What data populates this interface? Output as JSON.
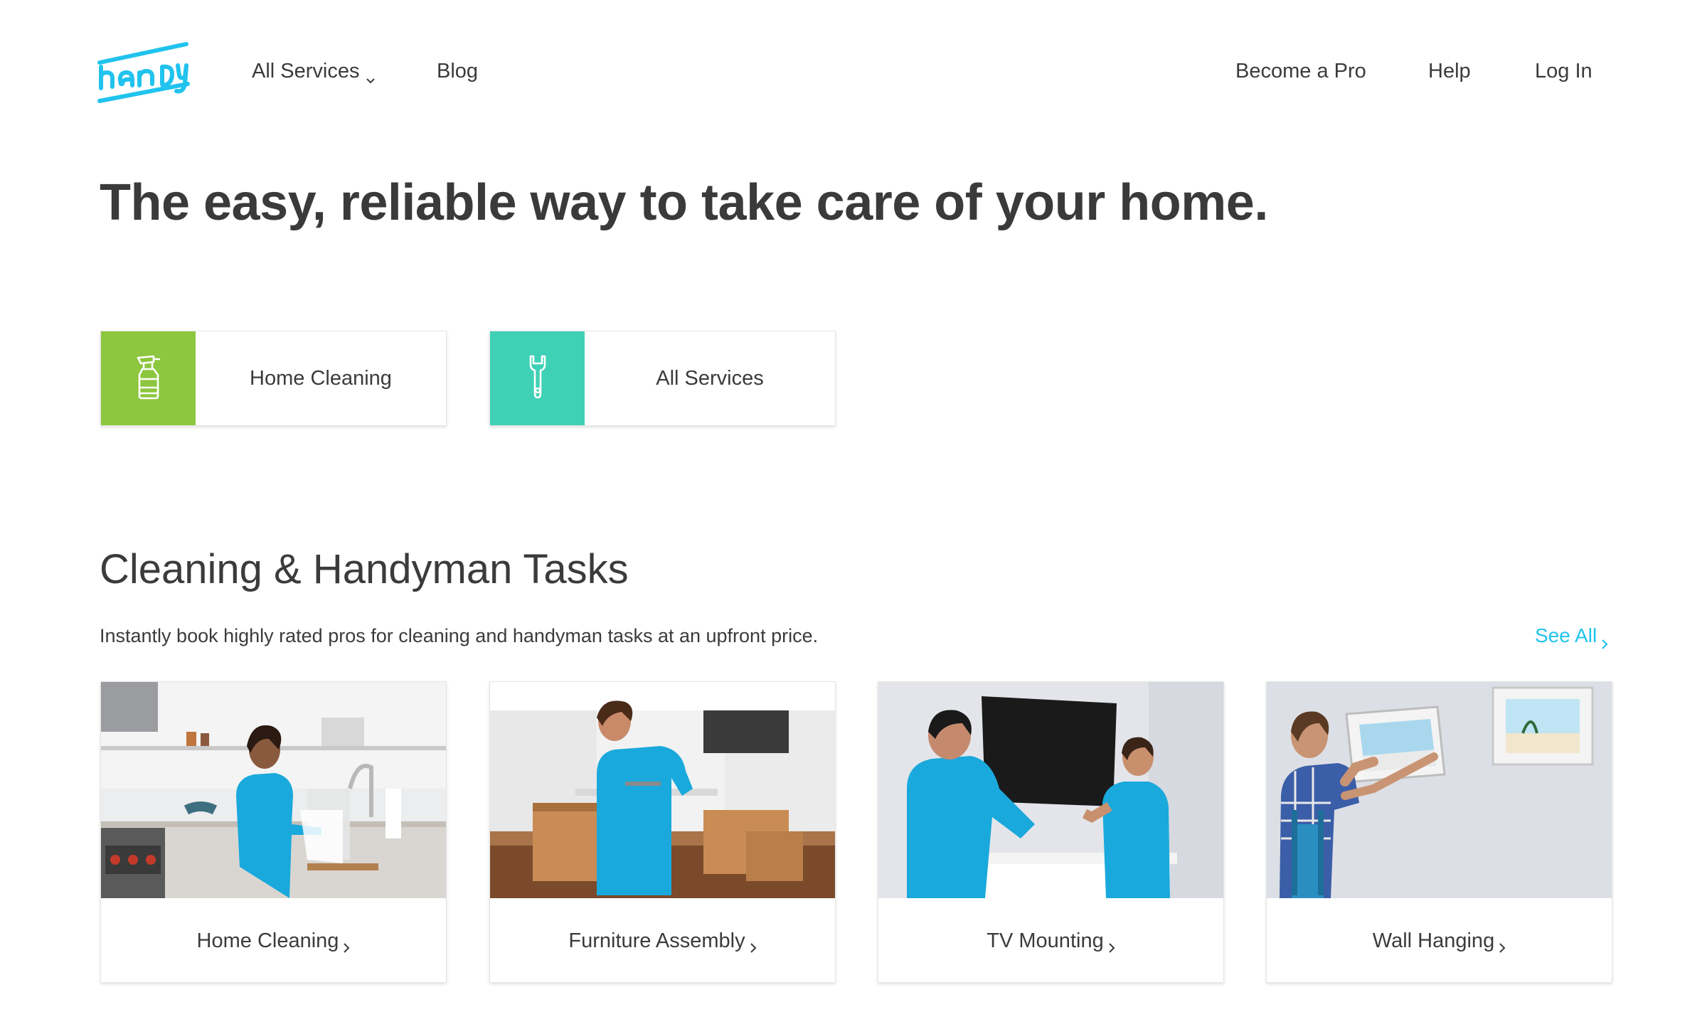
{
  "header": {
    "logo_text": "handy",
    "nav_left": [
      {
        "label": "All Services",
        "has_dropdown": true
      },
      {
        "label": "Blog"
      }
    ],
    "nav_right": [
      {
        "label": "Become a Pro"
      },
      {
        "label": "Help"
      },
      {
        "label": "Log In"
      }
    ]
  },
  "hero": {
    "title": "The easy, reliable way to take care of your home."
  },
  "service_buttons": [
    {
      "label": "Home Cleaning",
      "icon": "spray-bottle-icon",
      "color": "#8dc63f"
    },
    {
      "label": "All Services",
      "icon": "wrench-icon",
      "color": "#3fd1b5"
    }
  ],
  "section": {
    "title": "Cleaning & Handyman Tasks",
    "subtitle": "Instantly book highly rated pros for cleaning and handyman tasks at an upfront price.",
    "see_all": "See All"
  },
  "task_cards": [
    {
      "label": "Home Cleaning"
    },
    {
      "label": "Furniture Assembly"
    },
    {
      "label": "TV Mounting"
    },
    {
      "label": "Wall Hanging"
    }
  ],
  "colors": {
    "brand": "#21c3ee",
    "text": "#3b3b3b",
    "shirt": "#1aa9dc"
  }
}
